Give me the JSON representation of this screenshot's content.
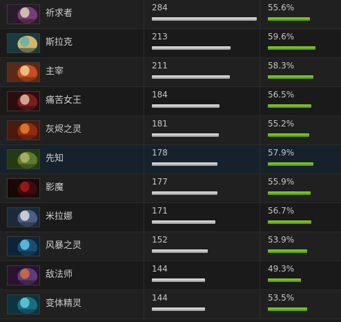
{
  "heroes": [
    {
      "name": "祈求者",
      "matches": "284",
      "winrate": "55.6%",
      "match_fraction": 1.0,
      "winrate_fraction": 0.556,
      "icon": "invoker-portrait-icon",
      "colors": [
        "#2b1a2e",
        "#d8c8b6",
        "#7a3d72"
      ]
    },
    {
      "name": "斯拉克",
      "matches": "213",
      "winrate": "59.6%",
      "match_fraction": 0.75,
      "winrate_fraction": 0.596,
      "icon": "slark-portrait-icon",
      "colors": [
        "#1a3b3f",
        "#5fb5a7",
        "#d6b36c"
      ]
    },
    {
      "name": "主宰",
      "matches": "211",
      "winrate": "58.3%",
      "match_fraction": 0.743,
      "winrate_fraction": 0.583,
      "icon": "juggernaut-portrait-icon",
      "colors": [
        "#5b2a16",
        "#f1c98a",
        "#c84d25"
      ]
    },
    {
      "name": "痛苦女王",
      "matches": "184",
      "winrate": "56.5%",
      "match_fraction": 0.648,
      "winrate_fraction": 0.565,
      "icon": "queen-of-pain-portrait-icon",
      "colors": [
        "#2c0d0d",
        "#d9b4a2",
        "#7a1d1d"
      ]
    },
    {
      "name": "灰烬之灵",
      "matches": "181",
      "winrate": "55.2%",
      "match_fraction": 0.637,
      "winrate_fraction": 0.552,
      "icon": "ember-spirit-portrait-icon",
      "colors": [
        "#4a1b0d",
        "#e37a2b",
        "#8f2c14"
      ]
    },
    {
      "name": "先知",
      "matches": "178",
      "winrate": "57.9%",
      "match_fraction": 0.627,
      "winrate_fraction": 0.579,
      "icon": "natures-prophet-portrait-icon",
      "colors": [
        "#243a14",
        "#b3b06c",
        "#5b7b2c"
      ]
    },
    {
      "name": "影魔",
      "matches": "177",
      "winrate": "55.9%",
      "match_fraction": 0.623,
      "winrate_fraction": 0.559,
      "icon": "shadow-fiend-portrait-icon",
      "colors": [
        "#1b0707",
        "#a11818",
        "#3d0c0c"
      ]
    },
    {
      "name": "米拉娜",
      "matches": "171",
      "winrate": "56.7%",
      "match_fraction": 0.602,
      "winrate_fraction": 0.567,
      "icon": "mirana-portrait-icon",
      "colors": [
        "#1b2a38",
        "#d5d6df",
        "#4d5f85"
      ]
    },
    {
      "name": "风暴之灵",
      "matches": "152",
      "winrate": "53.9%",
      "match_fraction": 0.535,
      "winrate_fraction": 0.539,
      "icon": "storm-spirit-portrait-icon",
      "colors": [
        "#0c2436",
        "#5cc0e6",
        "#1b4e6e"
      ]
    },
    {
      "name": "敌法师",
      "matches": "144",
      "winrate": "49.3%",
      "match_fraction": 0.507,
      "winrate_fraction": 0.493,
      "icon": "anti-mage-portrait-icon",
      "colors": [
        "#2b1330",
        "#d06b3f",
        "#5b3e7d"
      ]
    },
    {
      "name": "变体精灵",
      "matches": "144",
      "winrate": "53.5%",
      "match_fraction": 0.507,
      "winrate_fraction": 0.535,
      "icon": "morphling-portrait-icon",
      "colors": [
        "#0d3340",
        "#5ec9d8",
        "#1e6b80"
      ]
    }
  ]
}
